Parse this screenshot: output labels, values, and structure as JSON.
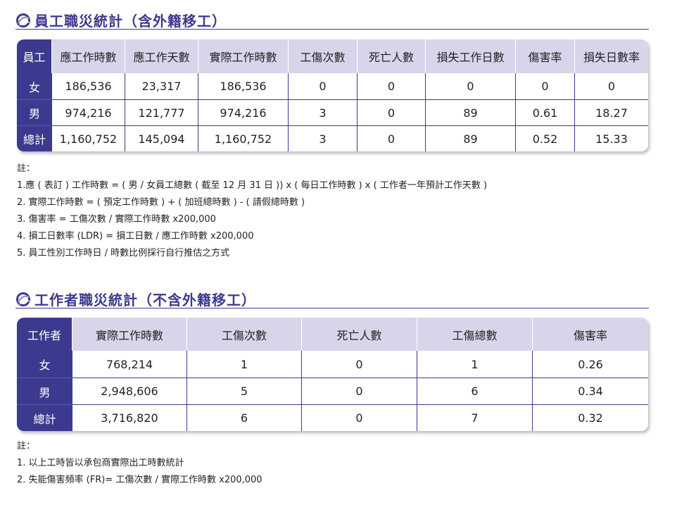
{
  "section1": {
    "title": "員工職災統計（含外籍移工）",
    "headers": [
      "員工",
      "應工作時數",
      "應工作天數",
      "實際工作時數",
      "工傷次數",
      "死亡人數",
      "損失工作日數",
      "傷害率",
      "損失日數率"
    ],
    "rows": [
      {
        "label": "女",
        "cells": [
          "186,536",
          "23,317",
          "186,536",
          "0",
          "0",
          "0",
          "0",
          "0"
        ]
      },
      {
        "label": "男",
        "cells": [
          "974,216",
          "121,777",
          "974,216",
          "3",
          "0",
          "89",
          "0.61",
          "18.27"
        ]
      },
      {
        "label": "總計",
        "cells": [
          "1,160,752",
          "145,094",
          "1,160,752",
          "3",
          "0",
          "89",
          "0.52",
          "15.33"
        ]
      }
    ],
    "notes": [
      "註：",
      "1.應 ( 表訂 ) 工作時數 = ( 男 / 女員工總數 ( 截至 12 月 31 日 )) x ( 每日工作時數 ) x ( 工作者一年預計工作天數 )",
      "2. 實際工作時數 = ( 預定工作時數 ) + ( 加班總時數 ) - ( 請假總時數 )",
      "3. 傷害率 = 工傷次數 / 實際工作時數 x200,000",
      "4. 損工日數率 (LDR) = 損工日數 / 應工作時數 x200,000",
      "5. 員工性別工作時日 / 時數比例採行自行推估之方式"
    ]
  },
  "section2": {
    "title": "工作者職災統計（不含外籍移工）",
    "headers": [
      "工作者",
      "實際工作時數",
      "工傷次數",
      "死亡人數",
      "工傷總數",
      "傷害率"
    ],
    "rows": [
      {
        "label": "女",
        "cells": [
          "768,214",
          "1",
          "0",
          "1",
          "0.26"
        ]
      },
      {
        "label": "男",
        "cells": [
          "2,948,606",
          "5",
          "0",
          "6",
          "0.34"
        ]
      },
      {
        "label": "總計",
        "cells": [
          "3,716,820",
          "6",
          "0",
          "7",
          "0.32"
        ]
      }
    ],
    "notes": [
      "註：",
      "1. 以上工時皆以承包商實際出工時數統計",
      "2. 失能傷害頻率 (FR)= 工傷次數 / 實際工作時數 x200,000"
    ]
  },
  "colors": {
    "accent": "#3c3a8e",
    "header_fill": "#d8d5eb"
  },
  "icons": {
    "section_icon": "ring-swirl-icon"
  }
}
